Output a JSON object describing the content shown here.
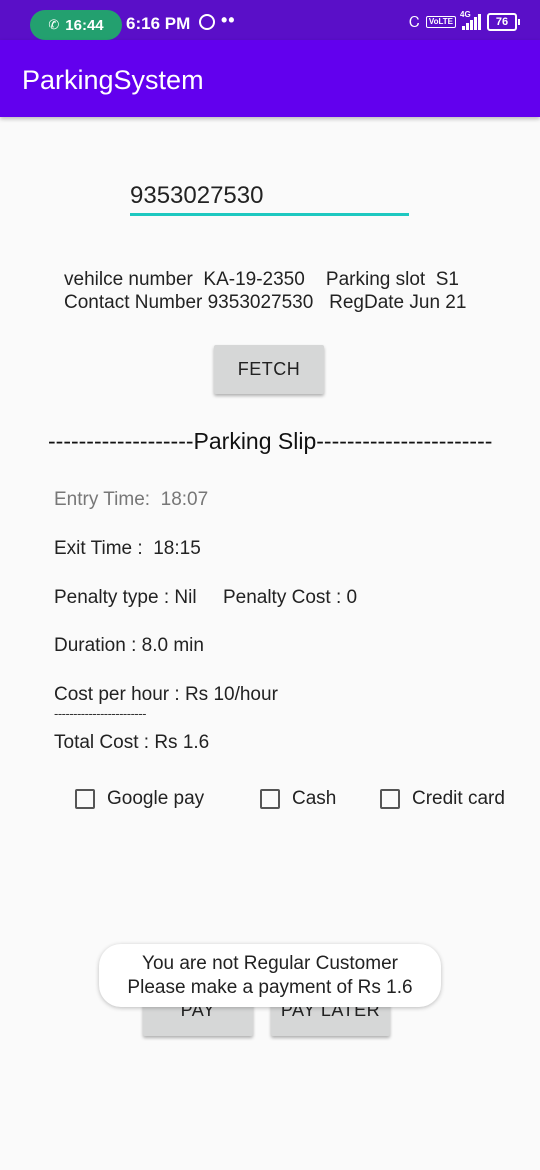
{
  "status_bar": {
    "call_time": "16:44",
    "clock": "6:16 PM",
    "dots": "••",
    "network": "4G",
    "volte": "VoLTE",
    "battery": "76"
  },
  "app_bar": {
    "title": "ParkingSystem"
  },
  "contact_input": {
    "value": "9353027530"
  },
  "vehicle_info": {
    "line1": "vehilce number  KA-19-2350    Parking slot  S1",
    "line2": "Contact Number 9353027530   RegDate Jun 21"
  },
  "fetch_button": {
    "label": "FETCH"
  },
  "slip": {
    "header": "-------------------Parking Slip-----------------------",
    "entry_time": "Entry Time:  18:07",
    "exit_time": "Exit Time :  18:15",
    "penalty": "Penalty type : Nil     Penalty Cost : 0",
    "duration": "Duration : 8.0 min",
    "cost_per_hour": "Cost per hour : Rs 10/hour",
    "divider": "------------------------",
    "total_cost": "Total Cost : Rs 1.6"
  },
  "payment_options": [
    {
      "label": "Google pay",
      "checked": false
    },
    {
      "label": "Cash",
      "checked": false
    },
    {
      "label": "Credit card",
      "checked": false
    }
  ],
  "buttons": {
    "pay": "PAY",
    "pay_later": "PAY LATER"
  },
  "toast": {
    "line1": "You are not Regular Customer",
    "line2": "Please make a payment of Rs 1.6"
  },
  "colors": {
    "status_bar": "#5a0fc8",
    "app_bar": "#6200ee",
    "input_underline": "#1ec8c0",
    "call_pill": "#23a06f",
    "button": "#d6d7d7"
  }
}
